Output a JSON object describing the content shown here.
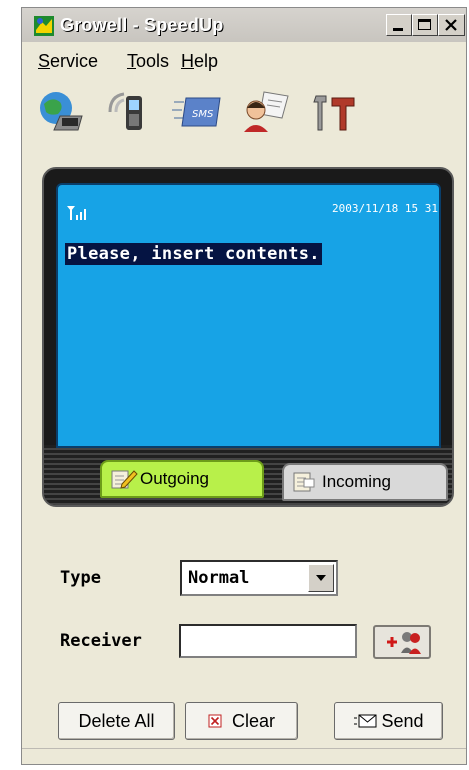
{
  "window": {
    "title": "Growell - SpeedUp"
  },
  "menu": [
    {
      "label": "Service",
      "underline": "S",
      "rest": "ervice"
    },
    {
      "label": "Tools",
      "underline": "T",
      "rest": "ools"
    },
    {
      "label": "Help",
      "underline": "H",
      "rest": "elp"
    }
  ],
  "toolbar": {
    "icons": [
      "globe-laptop-icon",
      "mobile-phone-icon",
      "sms-icon",
      "person-card-icon",
      "tools-icon"
    ]
  },
  "phone": {
    "datetime": "2003/11/18 15 31",
    "message": "Please, insert contents.",
    "tabs": {
      "outgoing": "Outgoing",
      "incoming": "Incoming"
    }
  },
  "form": {
    "type_label": "Type",
    "type_value": "Normal",
    "receiver_label": "Receiver",
    "receiver_value": ""
  },
  "buttons": {
    "delete_all": "Delete All",
    "clear": "Clear",
    "send": "Send"
  },
  "colors": {
    "screen": "#17a3e6",
    "outgoing_tab": "#b8f04a",
    "message_highlight": "#051443"
  }
}
